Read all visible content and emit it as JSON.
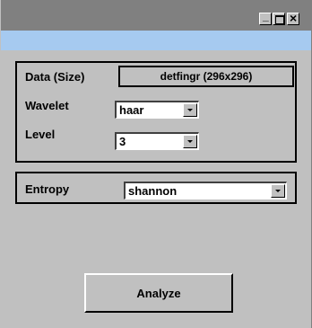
{
  "titlebar": {
    "minimize_label": "_",
    "maximize_icon": "maximize-icon",
    "close_label": "×"
  },
  "data_group": {
    "data_label": "Data (Size)",
    "data_value": "detfingr (296x296)",
    "wavelet_label": "Wavelet",
    "wavelet_value": "haar",
    "level_label": "Level",
    "level_value": "3"
  },
  "entropy_group": {
    "entropy_label": "Entropy",
    "entropy_value": "shannon"
  },
  "analyze_label": "Analyze"
}
